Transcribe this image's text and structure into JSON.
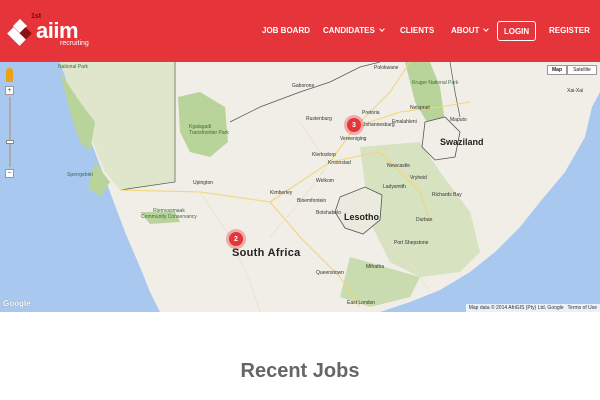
{
  "brand": {
    "small": "1st",
    "word": "aiim",
    "sub": "recruiting",
    "color": "#e5343a"
  },
  "nav": {
    "items": [
      {
        "label": "JOB BOARD"
      },
      {
        "label": "CANDIDATES"
      },
      {
        "label": "CLIENTS"
      },
      {
        "label": "ABOUT"
      }
    ],
    "login": "LOGIN",
    "register": "REGISTER"
  },
  "map": {
    "type_buttons": [
      "Map",
      "Satellite"
    ],
    "zoom_in": "+",
    "zoom_out": "−",
    "clusters": [
      {
        "count": "3"
      },
      {
        "count": "2"
      }
    ],
    "labels": {
      "south_africa": "South Africa",
      "lesotho": "Lesotho",
      "swaziland": "Swaziland",
      "national_park": "National Park",
      "kgalagadi": "Kgalagadi Transfrontier Park",
      "gaborone": "Gaborone",
      "polokwane": "Polokwane",
      "kruger": "Kruger National Park",
      "xai_xai": "Xai-Xai",
      "el_rustenburg": "Rustenburg",
      "pretoria": "Pretoria",
      "johannesburg": "Johannesburg",
      "nelspruit": "Nelspruit",
      "emalahleni": "Emalahleni",
      "maputo": "Maputo",
      "vereeniging": "Vereeniging",
      "klerksdorp": "Klerksdorp",
      "kroonstad": "Kroonstad",
      "newcastle": "Newcastle",
      "vryheid": "Vryheid",
      "welkom": "Welkom",
      "upington": "Upington",
      "kimberley": "Kimberley",
      "ladysmith": "Ladysmith",
      "richards_bay": "Richards Bay",
      "bloemfontein": "Bloemfontein",
      "spergebiet": "Sperrgebiet",
      "riemvasmaak": "Riemvasmaak Community Conservancy",
      "botshabelo": "Botshabelo",
      "durban": "Durban",
      "port_shepstone": "Port Shepstone",
      "mthatha": "Mthatha",
      "queenstown": "Queenstown",
      "east_london": "East London"
    },
    "google": "Google",
    "attribution": "Map data © 2014 AfriGIS (Pty) Ltd, Google",
    "terms": "Terms of Use"
  },
  "section": {
    "title": "Recent Jobs"
  }
}
